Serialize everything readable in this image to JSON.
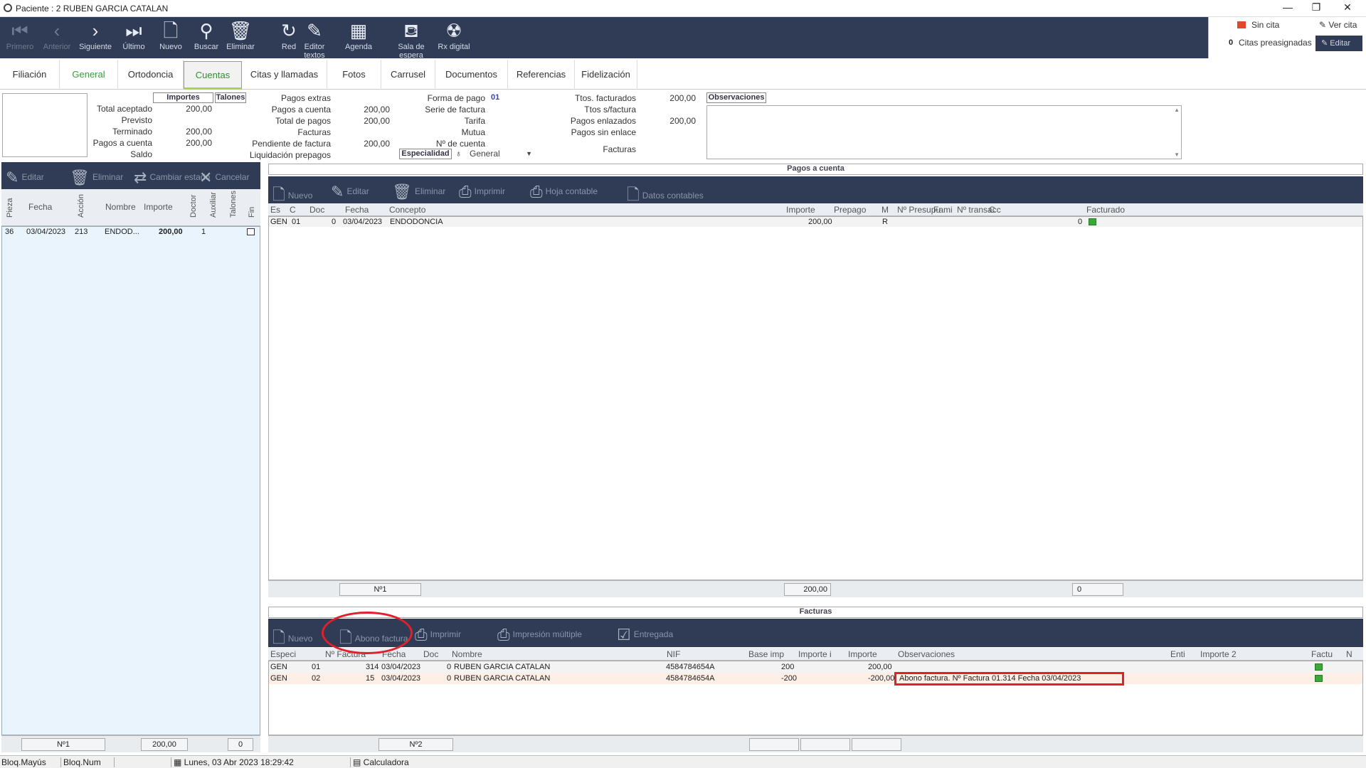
{
  "window": {
    "title": "Paciente : 2 RUBEN GARCIA CATALAN",
    "min": "—",
    "restore": "❐",
    "close": "✕"
  },
  "toolbar": [
    {
      "label": "Primero",
      "icon": "first-icon",
      "glyph": "⏮",
      "enabled": false
    },
    {
      "label": "Anterior",
      "icon": "prev-icon",
      "glyph": "‹",
      "enabled": false
    },
    {
      "label": "Siguiente",
      "icon": "next-icon",
      "glyph": "›",
      "enabled": true
    },
    {
      "label": "Último",
      "icon": "last-icon",
      "glyph": "⏭",
      "enabled": true
    },
    {
      "label": "Nuevo",
      "icon": "new-document-icon",
      "glyph": "🗋",
      "enabled": true
    },
    {
      "label": "Buscar",
      "icon": "search-icon",
      "glyph": "⚲",
      "enabled": true
    },
    {
      "label": "Eliminar",
      "icon": "trash-icon",
      "glyph": "🗑",
      "enabled": true
    },
    {
      "label": "Red",
      "icon": "refresh-icon",
      "glyph": "↻",
      "enabled": true
    },
    {
      "label": "Editor textos",
      "icon": "text-editor-icon",
      "glyph": "✎",
      "enabled": true
    },
    {
      "label": "Agenda",
      "icon": "calendar-icon",
      "glyph": "▦",
      "enabled": true
    },
    {
      "label": "Sala de espera",
      "icon": "sofa-icon",
      "glyph": "⛾",
      "enabled": true
    },
    {
      "label": "Rx digital",
      "icon": "radiation-icon",
      "glyph": "☢",
      "enabled": true
    }
  ],
  "top_right": {
    "sin_cita": "Sin cita",
    "ver_cita": "Ver cita",
    "citas_preasignadas": "Citas preasignadas",
    "citas_count": "0",
    "editar": "Editar"
  },
  "tabs": [
    "Filiación",
    "General",
    "Ortodoncia",
    "Cuentas",
    "Citas y llamadas",
    "Fotos",
    "Carrusel",
    "Documentos",
    "Referencias",
    "Fidelización"
  ],
  "active_tab": "Cuentas",
  "summary": {
    "importes_hdr": "Importes",
    "talones_hdr": "Talones",
    "left": [
      {
        "l": "Total aceptado",
        "v": "200,00"
      },
      {
        "l": "Previsto",
        "v": ""
      },
      {
        "l": "Terminado",
        "v": "200,00"
      },
      {
        "l": "Pagos a cuenta",
        "v": "200,00"
      },
      {
        "l": "Saldo",
        "v": ""
      }
    ],
    "mid": [
      {
        "l": "Pagos extras",
        "v": ""
      },
      {
        "l": "Pagos a cuenta",
        "v": "200,00"
      },
      {
        "l": "Total de pagos",
        "v": "200,00"
      },
      {
        "l": "Facturas",
        "v": ""
      },
      {
        "l": "Pendiente de factura",
        "v": "200,00"
      },
      {
        "l": "Liquidación prepagos",
        "v": ""
      }
    ],
    "mid2": [
      {
        "l": "Forma de pago",
        "v": "01"
      },
      {
        "l": "Serie de factura",
        "v": ""
      },
      {
        "l": "Tarifa",
        "v": ""
      },
      {
        "l": "Mutua",
        "v": ""
      },
      {
        "l": "Nº de cuenta",
        "v": ""
      }
    ],
    "especialidad_lbl": "Especialidad",
    "especialidad_val": "General",
    "right": [
      {
        "l": "Ttos. facturados",
        "v": "200,00"
      },
      {
        "l": "Ttos s/factura",
        "v": ""
      },
      {
        "l": "Pagos enlazados",
        "v": "200,00"
      },
      {
        "l": "Pagos sin enlace",
        "v": ""
      },
      {
        "l": "Facturas",
        "v": ""
      }
    ],
    "observaciones": "Observaciones"
  },
  "left_panel": {
    "buttons": [
      {
        "label": "Editar",
        "glyph": "✎",
        "icon": "edit-icon"
      },
      {
        "label": "Eliminar",
        "glyph": "🗑",
        "icon": "trash-icon"
      },
      {
        "label": "Cambiar estado",
        "glyph": "⇄",
        "icon": "swap-icon"
      },
      {
        "label": "Cancelar",
        "glyph": "✕",
        "icon": "cancel-icon"
      }
    ],
    "columns": [
      "Pieza",
      "Fecha",
      "Acción",
      "Nombre",
      "Importe",
      "Doctor",
      "Auxiliar",
      "Talones",
      "Fin"
    ],
    "rows": [
      {
        "pieza": "36",
        "fecha": "03/04/2023",
        "accion": "213",
        "nombre": "ENDOD...",
        "importe": "200,00",
        "doctor": "1"
      }
    ],
    "footer": {
      "n": "Nº1",
      "total": "200,00",
      "zero": "0"
    }
  },
  "pagos": {
    "title": "Pagos a cuenta",
    "buttons": [
      {
        "label": "Nuevo",
        "glyph": "🗋",
        "icon": "new-document-icon"
      },
      {
        "label": "Editar",
        "glyph": "✎",
        "icon": "edit-icon"
      },
      {
        "label": "Eliminar",
        "glyph": "🗑",
        "icon": "trash-icon"
      },
      {
        "label": "Imprimir",
        "glyph": "⎙",
        "icon": "printer-icon"
      },
      {
        "label": "Hoja contable",
        "glyph": "⎙",
        "icon": "ledger-printer-icon"
      },
      {
        "label": "Datos contables",
        "glyph": "🗋",
        "icon": "accounting-data-icon"
      }
    ],
    "columns": [
      "Es",
      "C",
      "Doc",
      "Fecha",
      "Concepto",
      "Importe",
      "Prepago",
      "M",
      "Nº Presupu",
      "Fami",
      "Nº transacc",
      "C",
      "Facturado"
    ],
    "rows": [
      {
        "es": "GEN",
        "c": "01",
        "doc": "0",
        "fecha": "03/04/2023",
        "concepto": "ENDODONCIA",
        "importe": "200,00",
        "m": "R",
        "c2": "0"
      }
    ],
    "footer": {
      "n": "Nº1",
      "total": "200,00",
      "zero": "0"
    }
  },
  "facturas": {
    "title": "Facturas",
    "buttons": [
      {
        "label": "Nuevo",
        "glyph": "🗋",
        "icon": "new-document-icon"
      },
      {
        "label": "Abono factura",
        "glyph": "🗋",
        "icon": "credit-invoice-icon"
      },
      {
        "label": "Imprimir",
        "glyph": "⎙",
        "icon": "printer-icon"
      },
      {
        "label": "Impresión múltiple",
        "glyph": "⎙",
        "icon": "multi-print-icon"
      },
      {
        "label": "Entregada",
        "glyph": "☑",
        "icon": "checkbox-icon"
      }
    ],
    "columns": [
      "Especi",
      "Nº Factura",
      "Fecha",
      "Doc",
      "Nombre",
      "NIF",
      "Base imp",
      "Importe i",
      "Importe",
      "Observaciones",
      "Enti",
      "Importe 2",
      "Factu",
      "N"
    ],
    "rows": [
      {
        "esp": "GEN",
        "serie": "01",
        "num": "314",
        "fecha": "03/04/2023",
        "doc": "0",
        "nombre": "RUBEN GARCIA CATALAN",
        "nif": "4584784654A",
        "base": "200",
        "importe": "200,00",
        "obs": ""
      },
      {
        "esp": "GEN",
        "serie": "02",
        "num": "15",
        "fecha": "03/04/2023",
        "doc": "0",
        "nombre": "RUBEN GARCIA CATALAN",
        "nif": "4584784654A",
        "base": "-200",
        "importe": "-200,00",
        "obs": "Abono factura. Nº Factura 01.314 Fecha 03/04/2023"
      }
    ],
    "footer": {
      "n": "Nº2"
    }
  },
  "status": {
    "caps": "Bloq.Mayús",
    "num": "Bloq.Num",
    "datetime": "Lunes, 03 Abr 2023 18:29:42",
    "calc": "Calculadora"
  },
  "colors": {
    "toolbar": "#303c55",
    "accent_green": "#a8d54a",
    "highlight_red": "#e0202a",
    "left_panel_bg": "#eaf4fc"
  }
}
